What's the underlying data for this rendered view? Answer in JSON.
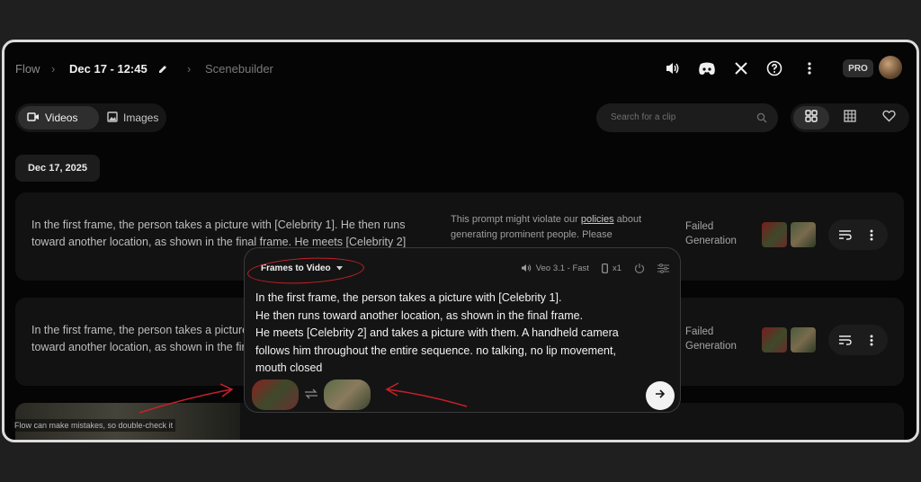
{
  "header": {
    "app_name": "Flow",
    "project_title": "Dec 17 - 12:45",
    "section": "Scenebuilder",
    "plan_badge": "PRO"
  },
  "toolbar": {
    "tabs": [
      {
        "label": "Videos",
        "icon": "video-icon",
        "active": true
      },
      {
        "label": "Images",
        "icon": "image-icon",
        "active": false
      }
    ],
    "search_placeholder": "Search for a clip"
  },
  "date_group": "Dec 17, 2025",
  "rows": [
    {
      "prompt": "In the first frame, the person takes a picture with [Celebrity 1]. He then runs toward another location, as shown in the final frame. He meets [Celebrity 2]",
      "warning_prefix": "This prompt might violate our ",
      "warning_link": "policies",
      "warning_suffix": " about generating prominent people. Please",
      "status": "Failed Generation"
    },
    {
      "prompt": "In the first frame, the person takes a picture with [Celebrity 1]. He then runs toward another location, as shown in the final frame.",
      "status": "Failed Generation"
    }
  ],
  "composer": {
    "mode": "Frames to Video",
    "model": "Veo 3.1 - Fast",
    "count": "x1",
    "prompt_lines": [
      "In the first frame, the person takes a picture with [Celebrity 1].",
      "He then runs toward another location, as shown in the final frame.",
      "He meets [Celebrity 2] and takes a picture with them. A handheld camera",
      "follows him throughout the entire sequence. no talking, no lip movement,",
      "mouth closed"
    ]
  },
  "toast": "Flow can make mistakes, so double-check it",
  "colors": {
    "background": "#050505",
    "card": "#121212",
    "annotation": "#c8202a"
  }
}
